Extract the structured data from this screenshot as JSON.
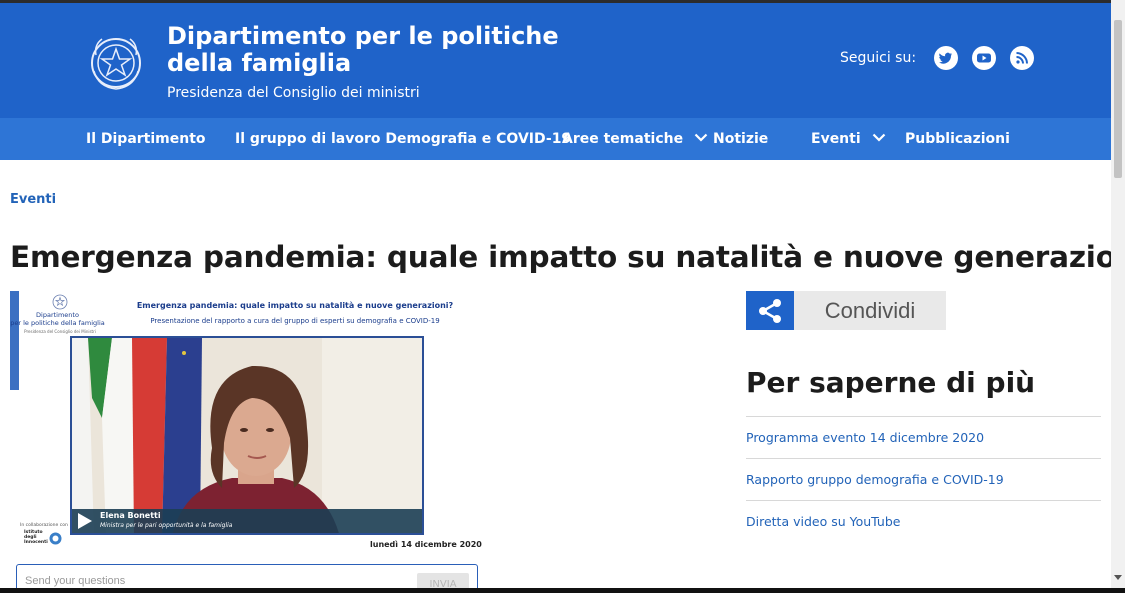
{
  "header": {
    "title_line1": "Dipartimento per le politiche",
    "title_line2": "della famiglia",
    "subtitle": "Presidenza del Consiglio dei ministri",
    "social_label": "Seguici su:",
    "social_icons": [
      "twitter-icon",
      "youtube-icon",
      "rss-icon"
    ]
  },
  "nav": {
    "items": [
      {
        "label": "Il Dipartimento"
      },
      {
        "label": "Il gruppo di lavoro Demografia e COVID-19"
      },
      {
        "label": "Aree tematiche"
      },
      {
        "label": "Notizie"
      },
      {
        "label": "Eventi"
      },
      {
        "label": "Pubblicazioni"
      }
    ]
  },
  "breadcrumb": "Eventi",
  "page_title": "Emergenza pandemia: quale impatto su natalità e nuove generazioni?",
  "video": {
    "dept_line1": "Dipartimento",
    "dept_line2": "per le politiche della famiglia",
    "dept_sub": "Presidenza del Consiglio dei Ministri",
    "title": "Emergenza pandemia: quale impatto su natalità e nuove generazioni?",
    "subtitle": "Presentazione del rapporto a cura del gruppo di esperti su demografia e COVID-19",
    "speaker_name": "Elena Bonetti",
    "speaker_role": "Ministra per le pari opportunità e la famiglia",
    "collab_label": "In collaborazione con",
    "partner_line1": "Istituto",
    "partner_line2": "degli",
    "partner_line3": "Innocenti",
    "date": "lunedì 14 dicembre 2020"
  },
  "question": {
    "placeholder": "Send your questions",
    "send_label": "INVIA"
  },
  "sidebar": {
    "share_label": "Condividi",
    "more_title": "Per saperne di più",
    "links": [
      {
        "label": "Programma evento 14 dicembre 2020"
      },
      {
        "label": "Rapporto gruppo demografia e COVID-19"
      },
      {
        "label": "Diretta video su YouTube"
      }
    ]
  },
  "colors": {
    "header_bg": "#1f63c9",
    "nav_bg": "#2e75d6",
    "link": "#2263b8"
  }
}
